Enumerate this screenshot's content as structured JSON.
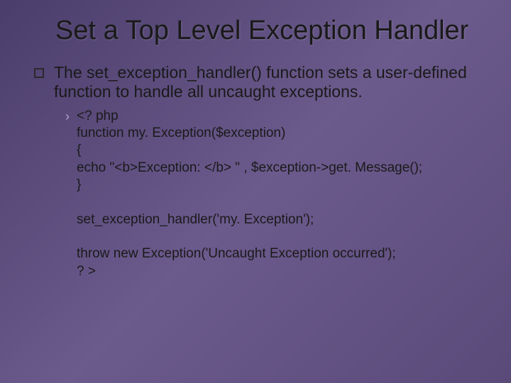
{
  "slide": {
    "title": "Set a Top Level Exception Handler",
    "body": "The set_exception_handler() function sets a user-defined function to handle all uncaught exceptions.",
    "code": "<? php\nfunction my. Exception($exception)\n{\necho \"<b>Exception: </b> \" , $exception->get. Message();\n}\n\nset_exception_handler('my. Exception');\n\nthrow new Exception('Uncaught Exception occurred');\n? >"
  }
}
